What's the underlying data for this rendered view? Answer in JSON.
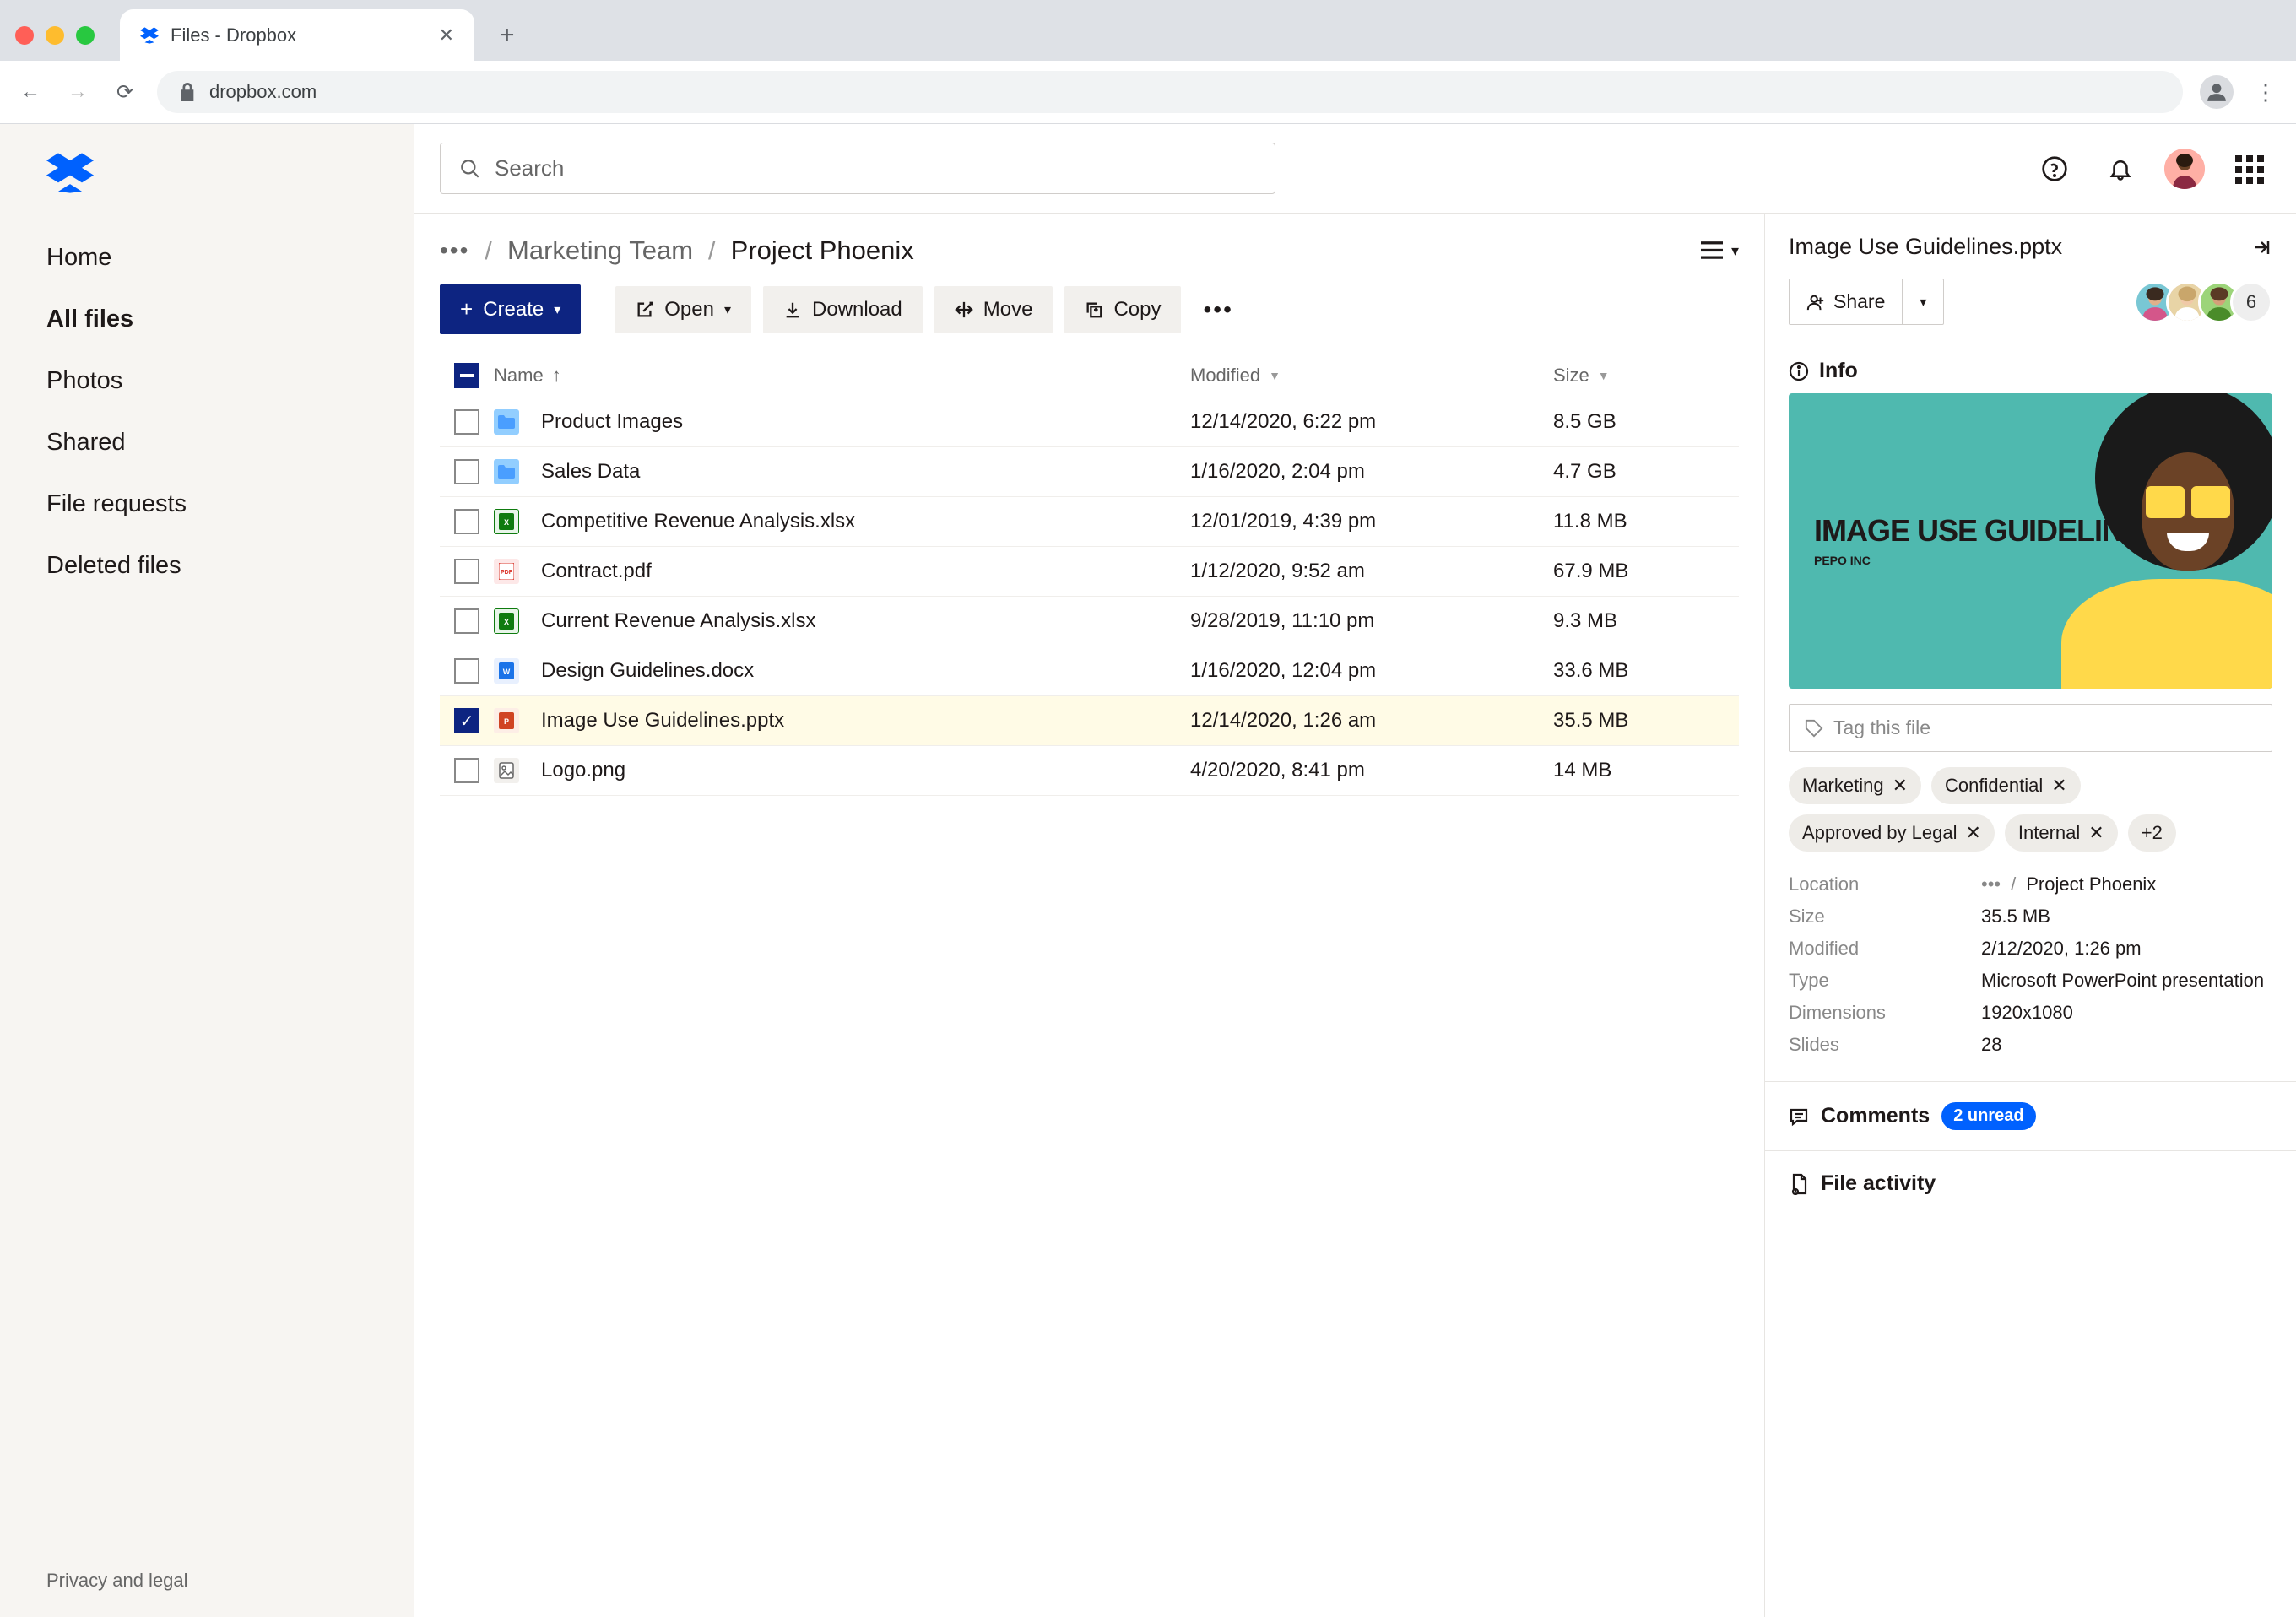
{
  "browser": {
    "tab_title": "Files - Dropbox",
    "url": "dropbox.com"
  },
  "search": {
    "placeholder": "Search"
  },
  "sidebar": {
    "items": [
      {
        "label": "Home"
      },
      {
        "label": "All files"
      },
      {
        "label": "Photos"
      },
      {
        "label": "Shared"
      },
      {
        "label": "File requests"
      },
      {
        "label": "Deleted files"
      }
    ],
    "active_index": 1,
    "footer": "Privacy and legal"
  },
  "breadcrumb": {
    "parent": "Marketing Team",
    "current": "Project Phoenix"
  },
  "toolbar": {
    "create": "Create",
    "open": "Open",
    "download": "Download",
    "move": "Move",
    "copy": "Copy"
  },
  "columns": {
    "name": "Name",
    "modified": "Modified",
    "size": "Size"
  },
  "files": [
    {
      "icon": "folder",
      "name": "Product Images",
      "modified": "12/14/2020, 6:22 pm",
      "size": "8.5 GB",
      "selected": false
    },
    {
      "icon": "folder",
      "name": "Sales Data",
      "modified": "1/16/2020, 2:04 pm",
      "size": "4.7 GB",
      "selected": false
    },
    {
      "icon": "xls",
      "name": "Competitive Revenue Analysis.xlsx",
      "modified": "12/01/2019, 4:39 pm",
      "size": "11.8 MB",
      "selected": false
    },
    {
      "icon": "pdf",
      "name": "Contract.pdf",
      "modified": "1/12/2020, 9:52 am",
      "size": "67.9 MB",
      "selected": false
    },
    {
      "icon": "xls",
      "name": "Current Revenue Analysis.xlsx",
      "modified": "9/28/2019, 11:10 pm",
      "size": "9.3 MB",
      "selected": false
    },
    {
      "icon": "doc",
      "name": "Design Guidelines.docx",
      "modified": "1/16/2020, 12:04 pm",
      "size": "33.6 MB",
      "selected": false
    },
    {
      "icon": "ppt",
      "name": "Image Use Guidelines.pptx",
      "modified": "12/14/2020, 1:26 am",
      "size": "35.5 MB",
      "selected": true
    },
    {
      "icon": "png",
      "name": "Logo.png",
      "modified": "4/20/2020, 8:41 pm",
      "size": "14 MB",
      "selected": false
    }
  ],
  "details": {
    "title": "Image Use Guidelines.pptx",
    "share_label": "Share",
    "members_count": "6",
    "info_label": "Info",
    "preview_title": "IMAGE USE GUIDELINES",
    "preview_subtitle": "PEPO INC",
    "tag_placeholder": "Tag this file",
    "tags": [
      {
        "label": "Marketing"
      },
      {
        "label": "Confidential"
      },
      {
        "label": "Approved by Legal"
      },
      {
        "label": "Internal"
      }
    ],
    "tags_more": "+2",
    "info": {
      "location_label": "Location",
      "location_value": "Project Phoenix",
      "size_label": "Size",
      "size_value": "35.5 MB",
      "modified_label": "Modified",
      "modified_value": "2/12/2020, 1:26 pm",
      "type_label": "Type",
      "type_value": "Microsoft PowerPoint presentation",
      "dimensions_label": "Dimensions",
      "dimensions_value": "1920x1080",
      "slides_label": "Slides",
      "slides_value": "28"
    },
    "comments_label": "Comments",
    "comments_badge": "2 unread",
    "activity_label": "File activity"
  }
}
